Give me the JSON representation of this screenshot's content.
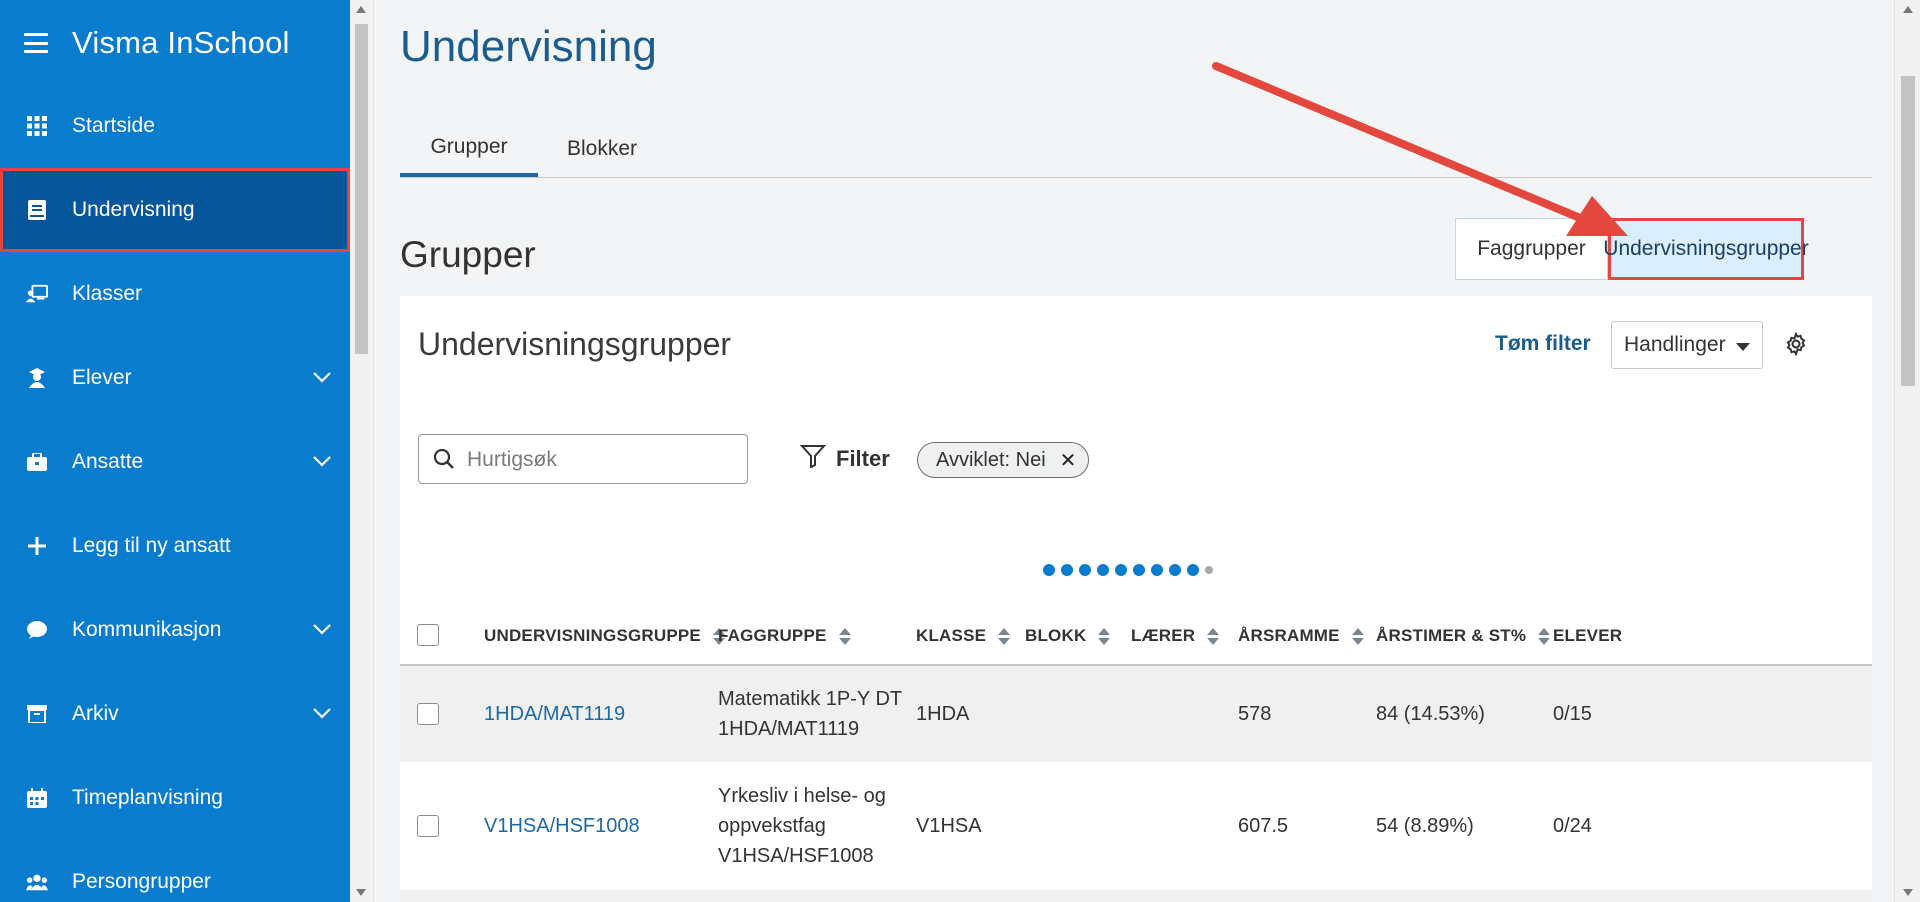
{
  "app": {
    "title": "Visma InSchool"
  },
  "sidebar": {
    "items": [
      {
        "label": "Startside",
        "icon": "grid-icon"
      },
      {
        "label": "Undervisning",
        "icon": "book-icon",
        "active": true
      },
      {
        "label": "Klasser",
        "icon": "classroom-icon"
      },
      {
        "label": "Elever",
        "icon": "student-icon",
        "expandable": true
      },
      {
        "label": "Ansatte",
        "icon": "briefcase-icon",
        "expandable": true
      },
      {
        "label": "Legg til ny ansatt",
        "icon": "plus-icon"
      },
      {
        "label": "Kommunikasjon",
        "icon": "chat-icon",
        "expandable": true
      },
      {
        "label": "Arkiv",
        "icon": "archive-icon",
        "expandable": true
      },
      {
        "label": "Timeplanvisning",
        "icon": "calendar-icon"
      },
      {
        "label": "Persongrupper",
        "icon": "people-icon"
      }
    ]
  },
  "main": {
    "title": "Undervisning",
    "tabs": [
      {
        "label": "Grupper",
        "active": true
      },
      {
        "label": "Blokker"
      }
    ],
    "section_title": "Grupper",
    "toggle": {
      "left": "Faggrupper",
      "right": "Undervisningsgrupper",
      "selected": "right"
    }
  },
  "card": {
    "title": "Undervisningsgrupper",
    "clear_filter": "Tøm filter",
    "actions": "Handlinger",
    "search": {
      "placeholder": "Hurtigsøk",
      "value": ""
    },
    "filter_label": "Filter",
    "chip": "Avviklet: Nei",
    "chip_close": "✕",
    "columns": [
      "UNDERVISNINGSGRUPPE",
      "FAGGRUPPE",
      "KLASSE",
      "BLOKK",
      "LÆRER",
      "ÅRSRAMME",
      "ÅRSTIMER & ST%",
      "ELEVER"
    ],
    "rows": [
      {
        "group": "1HDA/MAT1119",
        "subject_lines": [
          "Matematikk 1P-Y DT",
          "1HDA/MAT1119"
        ],
        "class": "1HDA",
        "block": "",
        "teacher": "",
        "year_frame": "578",
        "hours": "84 (14.53%)",
        "students": "0/15"
      },
      {
        "group": "V1HSA/HSF1008",
        "subject_lines": [
          "Yrkesliv i helse- og",
          "oppvekstfag",
          "V1HSA/HSF1008"
        ],
        "class": "V1HSA",
        "block": "",
        "teacher": "",
        "year_frame": "607.5",
        "hours": "54 (8.89%)",
        "students": "0/24"
      }
    ]
  },
  "colors": {
    "sidebar_bg": "#0a7ccd",
    "sidebar_active": "#05569a",
    "highlight_red": "#e4473d",
    "link_blue": "#1b6aa8",
    "selected_toggle_bg": "#daeeff"
  }
}
